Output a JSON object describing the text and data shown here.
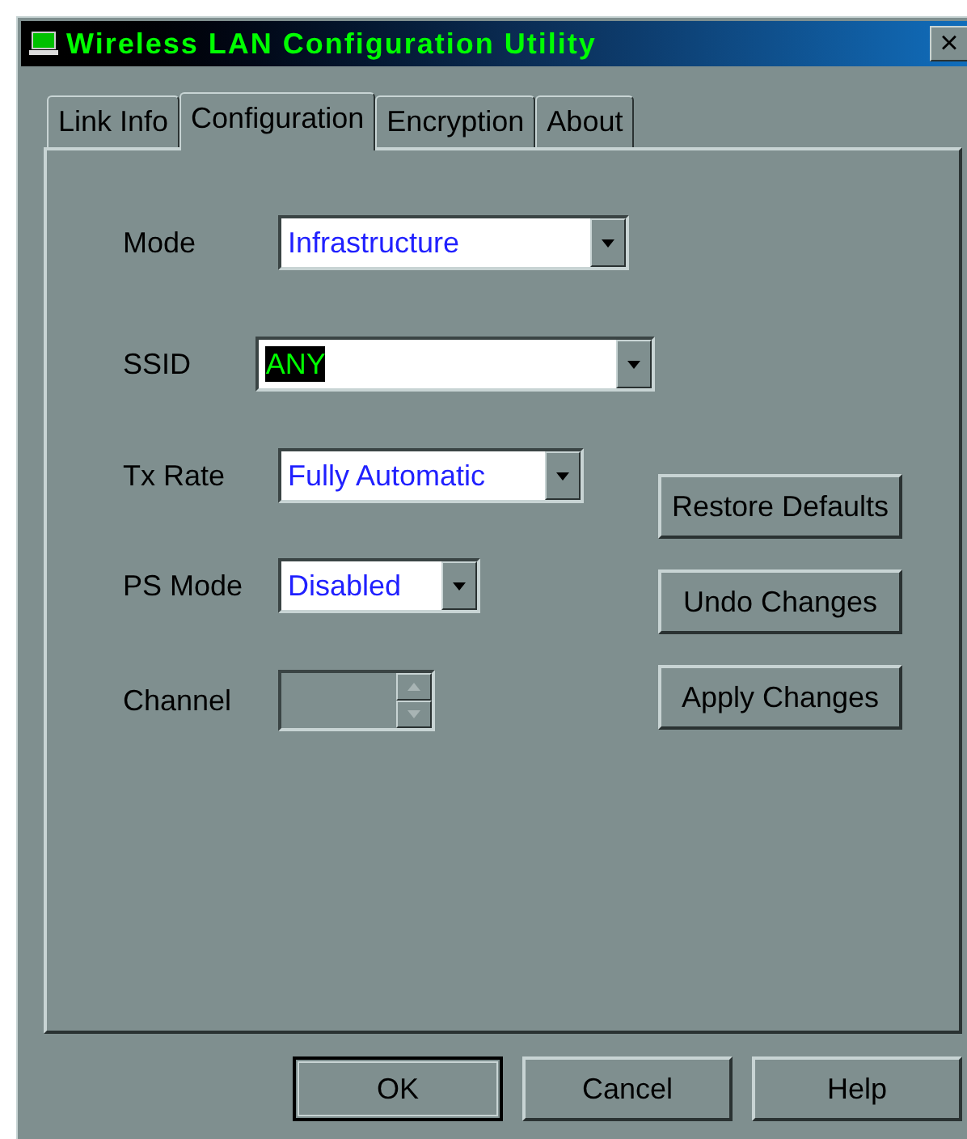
{
  "window": {
    "title": "Wireless LAN Configuration Utility",
    "close": "×"
  },
  "tabs": [
    {
      "label": "Link Info",
      "selected": false
    },
    {
      "label": "Configuration",
      "selected": true
    },
    {
      "label": "Encryption",
      "selected": false
    },
    {
      "label": "About",
      "selected": false
    }
  ],
  "fields": [
    {
      "kind": "combo",
      "label": "Mode",
      "value": "Infrastructure",
      "highlighted": false,
      "disabled": false
    },
    {
      "kind": "combo",
      "label": "SSID",
      "value": "ANY",
      "highlighted": true,
      "disabled": false
    },
    {
      "kind": "combo",
      "label": "Tx Rate",
      "value": "Fully Automatic",
      "highlighted": false,
      "disabled": false
    },
    {
      "kind": "combo",
      "label": "PS Mode",
      "value": "Disabled",
      "highlighted": false,
      "disabled": false
    },
    {
      "kind": "spinner",
      "label": "Channel",
      "disabled": true
    }
  ],
  "side_buttons": [
    "Restore Defaults",
    "Undo Changes",
    "Apply Changes"
  ],
  "footer_buttons": [
    {
      "label": "OK",
      "default": true
    },
    {
      "label": "Cancel",
      "default": false
    },
    {
      "label": "Help",
      "default": false
    }
  ]
}
